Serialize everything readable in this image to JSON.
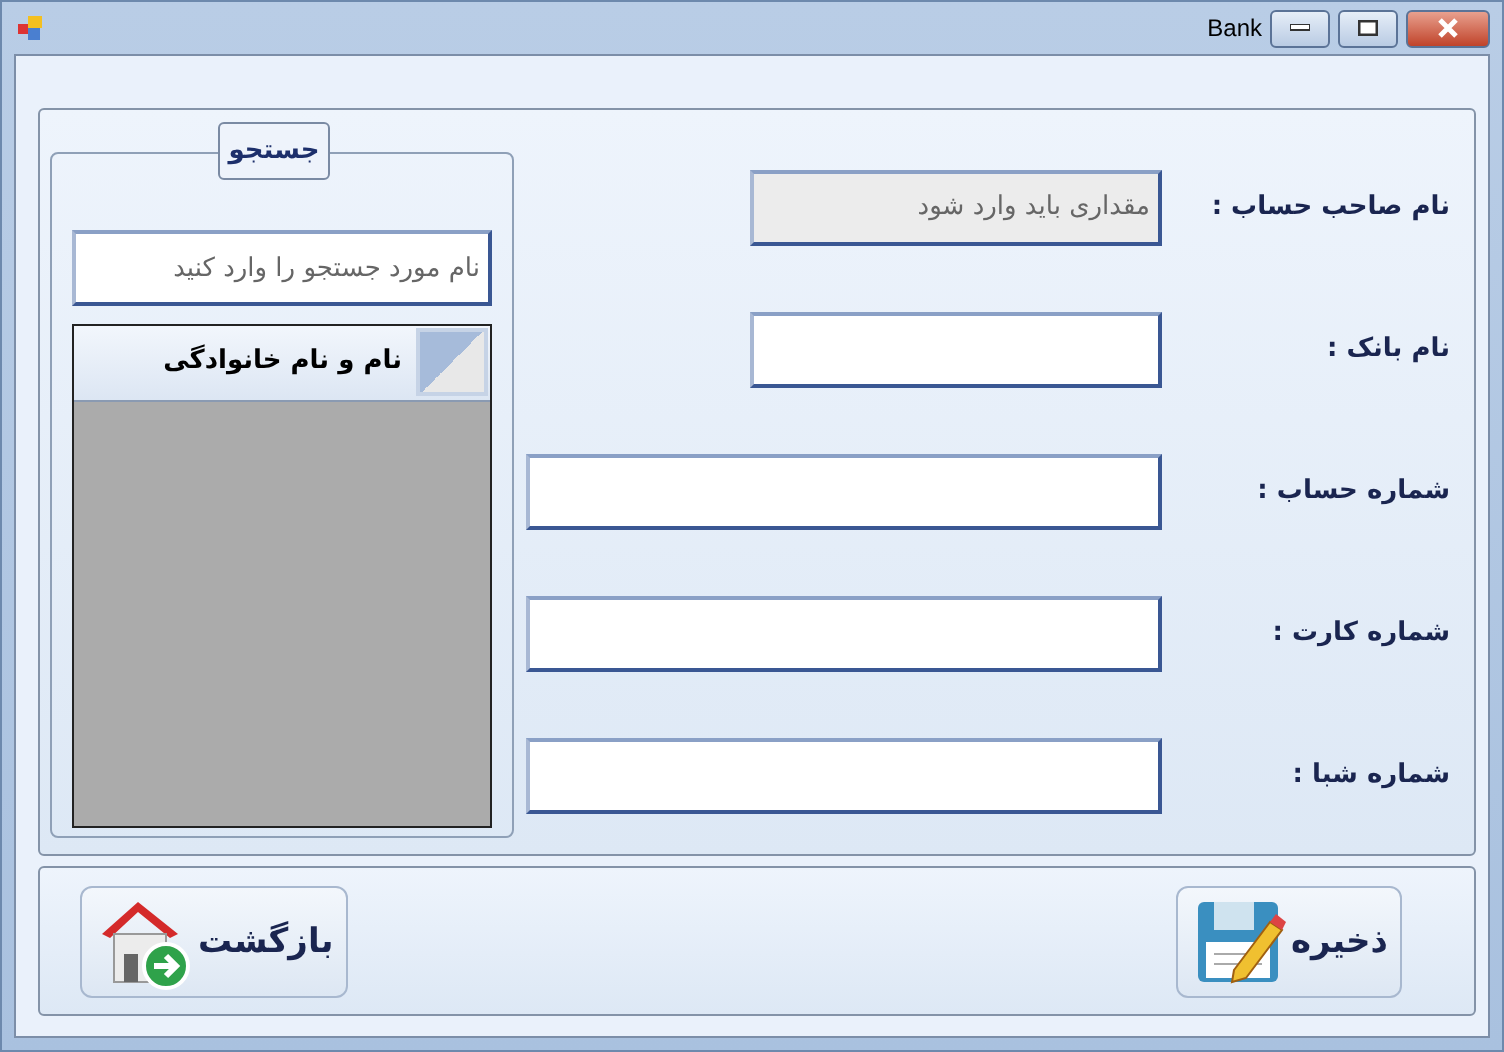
{
  "window": {
    "title": "Bank"
  },
  "search_group": {
    "title": "جستجو",
    "search": {
      "placeholder": "نام مورد جستجو را وارد کنید"
    },
    "grid": {
      "columns": [
        "نام و نام خانوادگی"
      ]
    }
  },
  "form": [
    {
      "label": "نام صاحب حساب :",
      "value": "مقداری باید وارد شود",
      "disabled": true,
      "kind": "short"
    },
    {
      "label": "نام بانک :",
      "disabled": false,
      "kind": "short"
    },
    {
      "label": "شماره حساب :",
      "disabled": false,
      "kind": "long"
    },
    {
      "label": "شماره کارت :",
      "disabled": false,
      "kind": "long"
    },
    {
      "label": "شماره شبا :",
      "disabled": false,
      "kind": "long"
    }
  ],
  "buttons": [
    {
      "kind": "save",
      "label": "ذخیره"
    },
    {
      "kind": "back",
      "label": "بازگشت"
    }
  ]
}
